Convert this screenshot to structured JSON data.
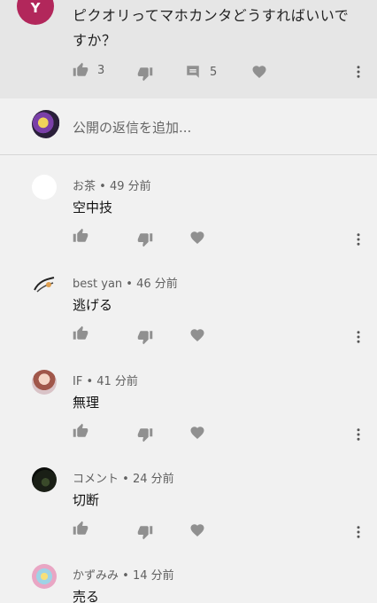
{
  "parent": {
    "avatar_glyph": "Y",
    "text": "ピクオリってマホカンタどうすればいいですか？",
    "likes": "3",
    "replies": "5"
  },
  "reply_input": {
    "placeholder": "公開の返信を追加..."
  },
  "comments": [
    {
      "author": "お茶",
      "time": "49 分前",
      "text": "空中技"
    },
    {
      "author": "best yan",
      "time": "46 分前",
      "text": "逃げる"
    },
    {
      "author": "IF",
      "time": "41 分前",
      "text": "無理"
    },
    {
      "author": "コメント",
      "time": "24 分前",
      "text": "切断"
    },
    {
      "author": "かずみみ",
      "time": "14 分前",
      "text": "売る"
    }
  ],
  "separator": " • ",
  "icons": {
    "like": "thumb-up-icon",
    "dislike": "thumb-down-icon",
    "reply": "comment-icon",
    "heart": "heart-icon",
    "menu": "more-vert-icon"
  },
  "colors": {
    "icon": "#909090",
    "parent_bg": "#e6e6e6",
    "page_bg": "#f1f1f1",
    "avatar_accent": "#b2275b"
  }
}
